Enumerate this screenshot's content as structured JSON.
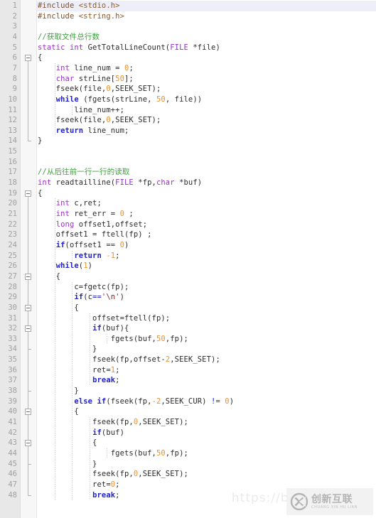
{
  "editor": {
    "language": "C",
    "total_lines_shown": 48,
    "first_line": 1,
    "last_line": 48,
    "current_line": 1,
    "colors": {
      "background": "#ffffff",
      "gutter_background": "#e8e8e8",
      "line_number": "#a0a0a0",
      "current_line_highlight": "#eeeef8",
      "preprocessor": "#7a5230",
      "comment": "#3f9f3f",
      "keyword_type": "#9a30c8",
      "keyword_control": "#2222cc",
      "number": "#f0902a",
      "string": "#8a1f1f",
      "plain_text": "#2b2b2b"
    }
  },
  "lines": [
    {
      "n": "1",
      "current": true,
      "tokens": [
        {
          "t": "#include ",
          "c": "pre"
        },
        {
          "t": "<stdio.h>",
          "c": "inc"
        }
      ]
    },
    {
      "n": "2",
      "tokens": [
        {
          "t": "#include ",
          "c": "pre"
        },
        {
          "t": "<string.h>",
          "c": "inc"
        }
      ]
    },
    {
      "n": "3",
      "tokens": []
    },
    {
      "n": "4",
      "tokens": [
        {
          "t": "//获取文件总行数",
          "c": "cmt"
        }
      ]
    },
    {
      "n": "5",
      "tokens": [
        {
          "t": "static",
          "c": "kw"
        },
        {
          "t": " ",
          "c": "plain"
        },
        {
          "t": "int",
          "c": "kw"
        },
        {
          "t": " GetTotalLineCount(",
          "c": "plain"
        },
        {
          "t": "FILE",
          "c": "type"
        },
        {
          "t": " *file)",
          "c": "plain"
        }
      ]
    },
    {
      "n": "6",
      "fold": "open",
      "tokens": [
        {
          "t": "{",
          "c": "plain"
        }
      ]
    },
    {
      "n": "7",
      "tokens": [
        {
          "t": "    ",
          "c": "plain"
        },
        {
          "t": "int",
          "c": "kw"
        },
        {
          "t": " line_num = ",
          "c": "plain"
        },
        {
          "t": "0",
          "c": "num"
        },
        {
          "t": ";",
          "c": "plain"
        }
      ]
    },
    {
      "n": "8",
      "tokens": [
        {
          "t": "    ",
          "c": "plain"
        },
        {
          "t": "char",
          "c": "kw"
        },
        {
          "t": " strLine[",
          "c": "plain"
        },
        {
          "t": "50",
          "c": "num"
        },
        {
          "t": "];",
          "c": "plain"
        }
      ]
    },
    {
      "n": "9",
      "tokens": [
        {
          "t": "    fseek(file,",
          "c": "plain"
        },
        {
          "t": "0",
          "c": "num"
        },
        {
          "t": ",SEEK_SET);",
          "c": "plain"
        }
      ]
    },
    {
      "n": "10",
      "tokens": [
        {
          "t": "    ",
          "c": "plain"
        },
        {
          "t": "while",
          "c": "ctrl"
        },
        {
          "t": " (fgets(strLine, ",
          "c": "plain"
        },
        {
          "t": "50",
          "c": "num"
        },
        {
          "t": ", file))",
          "c": "plain"
        }
      ]
    },
    {
      "n": "11",
      "tokens": [
        {
          "t": "        line_num++;",
          "c": "plain"
        }
      ]
    },
    {
      "n": "12",
      "tokens": [
        {
          "t": "    fseek(file,",
          "c": "plain"
        },
        {
          "t": "0",
          "c": "num"
        },
        {
          "t": ",SEEK_SET);",
          "c": "plain"
        }
      ]
    },
    {
      "n": "13",
      "tokens": [
        {
          "t": "    ",
          "c": "plain"
        },
        {
          "t": "return",
          "c": "ctrl"
        },
        {
          "t": " line_num;",
          "c": "plain"
        }
      ]
    },
    {
      "n": "14",
      "fold": "end",
      "tokens": [
        {
          "t": "}",
          "c": "plain"
        }
      ]
    },
    {
      "n": "15",
      "tokens": []
    },
    {
      "n": "16",
      "tokens": []
    },
    {
      "n": "17",
      "tokens": [
        {
          "t": "//从后往前一行一行的读取",
          "c": "cmt"
        }
      ]
    },
    {
      "n": "18",
      "tokens": [
        {
          "t": "int",
          "c": "kw"
        },
        {
          "t": " readtailline(",
          "c": "plain"
        },
        {
          "t": "FILE",
          "c": "type"
        },
        {
          "t": " *fp,",
          "c": "plain"
        },
        {
          "t": "char",
          "c": "kw"
        },
        {
          "t": " *buf)",
          "c": "plain"
        }
      ]
    },
    {
      "n": "19",
      "fold": "open",
      "tokens": [
        {
          "t": "{",
          "c": "plain"
        }
      ]
    },
    {
      "n": "20",
      "tokens": [
        {
          "t": "    ",
          "c": "plain"
        },
        {
          "t": "int",
          "c": "kw"
        },
        {
          "t": " c,ret;",
          "c": "plain"
        }
      ]
    },
    {
      "n": "21",
      "tokens": [
        {
          "t": "    ",
          "c": "plain"
        },
        {
          "t": "int",
          "c": "kw"
        },
        {
          "t": " ret_err = ",
          "c": "plain"
        },
        {
          "t": "0",
          "c": "num"
        },
        {
          "t": " ;",
          "c": "plain"
        }
      ]
    },
    {
      "n": "22",
      "tokens": [
        {
          "t": "    ",
          "c": "plain"
        },
        {
          "t": "long",
          "c": "kw"
        },
        {
          "t": " offset1,offset;",
          "c": "plain"
        }
      ]
    },
    {
      "n": "23",
      "tokens": [
        {
          "t": "    offset1 = ftell(fp) ;",
          "c": "plain"
        }
      ]
    },
    {
      "n": "24",
      "tokens": [
        {
          "t": "    ",
          "c": "plain"
        },
        {
          "t": "if",
          "c": "ctrl"
        },
        {
          "t": "(offset1 ",
          "c": "plain"
        },
        {
          "t": "==",
          "c": "op"
        },
        {
          "t": " ",
          "c": "plain"
        },
        {
          "t": "0",
          "c": "num"
        },
        {
          "t": ")",
          "c": "plain"
        }
      ]
    },
    {
      "n": "25",
      "tokens": [
        {
          "t": "        ",
          "c": "plain"
        },
        {
          "t": "return",
          "c": "ctrl"
        },
        {
          "t": " ",
          "c": "plain"
        },
        {
          "t": "-1",
          "c": "num"
        },
        {
          "t": ";",
          "c": "plain"
        }
      ]
    },
    {
      "n": "26",
      "tokens": [
        {
          "t": "    ",
          "c": "plain"
        },
        {
          "t": "while",
          "c": "ctrl"
        },
        {
          "t": "(",
          "c": "plain"
        },
        {
          "t": "1",
          "c": "num"
        },
        {
          "t": ")",
          "c": "plain"
        }
      ]
    },
    {
      "n": "27",
      "fold": "open",
      "tokens": [
        {
          "t": "    {",
          "c": "plain"
        }
      ]
    },
    {
      "n": "28",
      "tokens": [
        {
          "t": "        c=fgetc(fp);",
          "c": "plain"
        }
      ]
    },
    {
      "n": "29",
      "tokens": [
        {
          "t": "        ",
          "c": "plain"
        },
        {
          "t": "if",
          "c": "ctrl"
        },
        {
          "t": "(c",
          "c": "plain"
        },
        {
          "t": "==",
          "c": "op"
        },
        {
          "t": "'\\n'",
          "c": "str"
        },
        {
          "t": ")",
          "c": "plain"
        }
      ]
    },
    {
      "n": "30",
      "fold": "open",
      "tokens": [
        {
          "t": "        {",
          "c": "plain"
        }
      ]
    },
    {
      "n": "31",
      "tokens": [
        {
          "t": "            offset=ftell(fp);",
          "c": "plain"
        }
      ]
    },
    {
      "n": "32",
      "fold": "open",
      "tokens": [
        {
          "t": "            ",
          "c": "plain"
        },
        {
          "t": "if",
          "c": "ctrl"
        },
        {
          "t": "(buf){",
          "c": "plain"
        }
      ]
    },
    {
      "n": "33",
      "tokens": [
        {
          "t": "                fgets(buf,",
          "c": "plain"
        },
        {
          "t": "50",
          "c": "num"
        },
        {
          "t": ",fp);",
          "c": "plain"
        }
      ]
    },
    {
      "n": "34",
      "fold": "end",
      "tokens": [
        {
          "t": "            }",
          "c": "plain"
        }
      ]
    },
    {
      "n": "35",
      "tokens": [
        {
          "t": "            fseek(fp,offset-",
          "c": "plain"
        },
        {
          "t": "2",
          "c": "num"
        },
        {
          "t": ",SEEK_SET);",
          "c": "plain"
        }
      ]
    },
    {
      "n": "36",
      "tokens": [
        {
          "t": "            ret=",
          "c": "plain"
        },
        {
          "t": "1",
          "c": "num"
        },
        {
          "t": ";",
          "c": "plain"
        }
      ]
    },
    {
      "n": "37",
      "tokens": [
        {
          "t": "            ",
          "c": "plain"
        },
        {
          "t": "break",
          "c": "ctrl"
        },
        {
          "t": ";",
          "c": "plain"
        }
      ]
    },
    {
      "n": "38",
      "fold": "end",
      "tokens": [
        {
          "t": "        }",
          "c": "plain"
        }
      ]
    },
    {
      "n": "39",
      "tokens": [
        {
          "t": "        ",
          "c": "plain"
        },
        {
          "t": "else",
          "c": "ctrl"
        },
        {
          "t": " ",
          "c": "plain"
        },
        {
          "t": "if",
          "c": "ctrl"
        },
        {
          "t": "(fseek(fp,",
          "c": "plain"
        },
        {
          "t": "-2",
          "c": "num"
        },
        {
          "t": ",SEEK_CUR) ",
          "c": "plain"
        },
        {
          "t": "!=",
          "c": "op"
        },
        {
          "t": " ",
          "c": "plain"
        },
        {
          "t": "0",
          "c": "num"
        },
        {
          "t": ")",
          "c": "plain"
        }
      ]
    },
    {
      "n": "40",
      "fold": "open",
      "tokens": [
        {
          "t": "        {",
          "c": "plain"
        }
      ]
    },
    {
      "n": "41",
      "tokens": [
        {
          "t": "            fseek(fp,",
          "c": "plain"
        },
        {
          "t": "0",
          "c": "num"
        },
        {
          "t": ",SEEK_SET);",
          "c": "plain"
        }
      ]
    },
    {
      "n": "42",
      "tokens": [
        {
          "t": "            ",
          "c": "plain"
        },
        {
          "t": "if",
          "c": "ctrl"
        },
        {
          "t": "(buf)",
          "c": "plain"
        }
      ]
    },
    {
      "n": "43",
      "fold": "open",
      "tokens": [
        {
          "t": "            {",
          "c": "plain"
        }
      ]
    },
    {
      "n": "44",
      "tokens": [
        {
          "t": "                fgets(buf,",
          "c": "plain"
        },
        {
          "t": "50",
          "c": "num"
        },
        {
          "t": ",fp);",
          "c": "plain"
        }
      ]
    },
    {
      "n": "45",
      "fold": "end",
      "tokens": [
        {
          "t": "            }",
          "c": "plain"
        }
      ]
    },
    {
      "n": "46",
      "tokens": [
        {
          "t": "            fseek(fp,",
          "c": "plain"
        },
        {
          "t": "0",
          "c": "num"
        },
        {
          "t": ",SEEK_SET);",
          "c": "plain"
        }
      ]
    },
    {
      "n": "47",
      "tokens": [
        {
          "t": "            ret=",
          "c": "plain"
        },
        {
          "t": "0",
          "c": "num"
        },
        {
          "t": ";",
          "c": "plain"
        }
      ]
    },
    {
      "n": "48",
      "tokens": [
        {
          "t": "            ",
          "c": "plain"
        },
        {
          "t": "break",
          "c": "ctrl"
        },
        {
          "t": ";",
          "c": "plain"
        }
      ]
    }
  ],
  "fold_runs": [
    {
      "from_line": 6,
      "to_line": 14
    },
    {
      "from_line": 19,
      "to_line": 48
    },
    {
      "from_line": 27,
      "to_line": 48
    },
    {
      "from_line": 30,
      "to_line": 38
    },
    {
      "from_line": 32,
      "to_line": 34
    },
    {
      "from_line": 40,
      "to_line": 48
    },
    {
      "from_line": 43,
      "to_line": 45
    }
  ],
  "watermark": {
    "url_text": "https://blog.csdn.net",
    "logo_cn": "创新互联",
    "logo_pinyin": "CHUANG XIN HU LIAN",
    "logo_mark": "cx-logo-icon"
  }
}
